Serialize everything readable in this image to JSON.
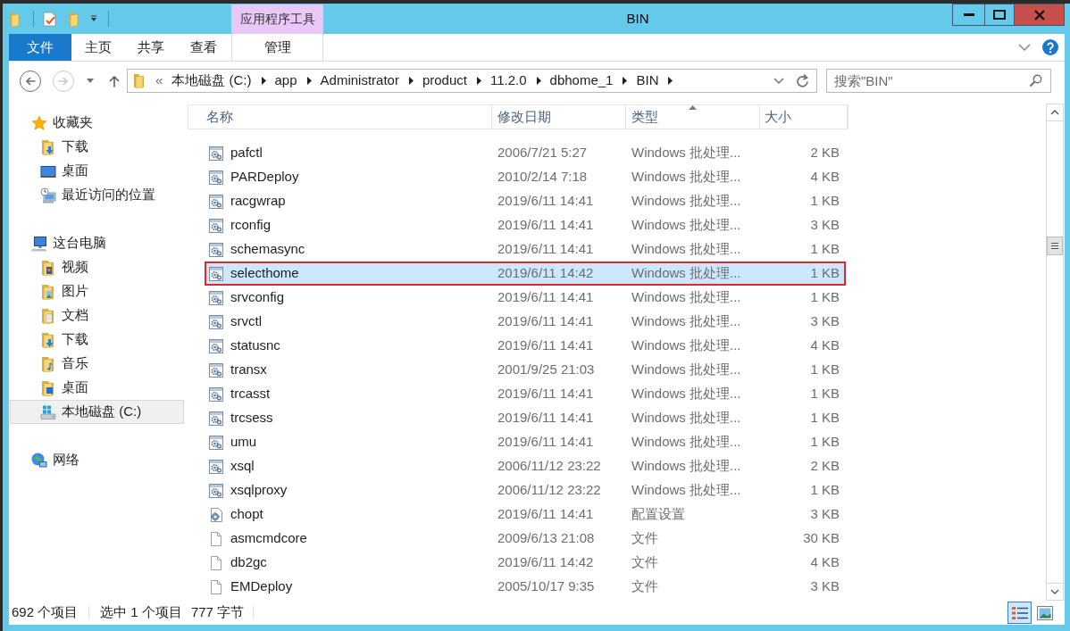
{
  "window": {
    "title": "BIN",
    "context_group": "应用程序工具"
  },
  "ribbon_tabs": [
    {
      "label": "文件",
      "kind": "file",
      "selected": false
    },
    {
      "label": "主页",
      "kind": "tab",
      "selected": false
    },
    {
      "label": "共享",
      "kind": "tab",
      "selected": false
    },
    {
      "label": "查看",
      "kind": "tab",
      "selected": false
    },
    {
      "label": "管理",
      "kind": "contextual",
      "selected": false
    }
  ],
  "navigation": [
    {
      "kind": "back",
      "disabled": false
    },
    {
      "kind": "forward",
      "disabled": true
    }
  ],
  "address_bar": {
    "overflow": "«",
    "path": [
      "本地磁盘 (C:)",
      "app",
      "Administrator",
      "product",
      "11.2.0",
      "dbhome_1",
      "BIN"
    ]
  },
  "search": {
    "placeholder": "搜索\"BIN\""
  },
  "sidebar": {
    "groups": [
      {
        "label": "收藏夹",
        "kind": "favorites",
        "selected": false,
        "children": [
          {
            "label": "下载",
            "kind": "downloads",
            "selected": false
          },
          {
            "label": "桌面",
            "kind": "desktop",
            "selected": false
          },
          {
            "label": "最近访问的位置",
            "kind": "recent",
            "selected": false
          }
        ]
      },
      {
        "label": "这台电脑",
        "kind": "computer",
        "selected": false,
        "children": [
          {
            "label": "视频",
            "kind": "videos",
            "selected": false
          },
          {
            "label": "图片",
            "kind": "pictures",
            "selected": false
          },
          {
            "label": "文档",
            "kind": "documents",
            "selected": false
          },
          {
            "label": "下载",
            "kind": "downloads",
            "selected": false
          },
          {
            "label": "音乐",
            "kind": "music",
            "selected": false
          },
          {
            "label": "桌面",
            "kind": "desktop_folder",
            "selected": false
          },
          {
            "label": "本地磁盘 (C:)",
            "kind": "drive",
            "selected": true
          }
        ]
      },
      {
        "label": "网络",
        "kind": "network",
        "selected": false
      }
    ]
  },
  "file_list": {
    "columns": [
      {
        "label": "名称",
        "sorted": false
      },
      {
        "label": "修改日期",
        "sorted": false
      },
      {
        "label": "类型",
        "sorted": true
      },
      {
        "label": "大小",
        "sorted": false
      }
    ],
    "rows": [
      {
        "kind": "batch",
        "name": "pafctl",
        "modified": "2006/7/21 5:27",
        "type": "Windows 批处理...",
        "size": "2 KB",
        "selected": false,
        "highlighted": false
      },
      {
        "kind": "batch",
        "name": "PARDeploy",
        "modified": "2010/2/14 7:18",
        "type": "Windows 批处理...",
        "size": "4 KB",
        "selected": false,
        "highlighted": false
      },
      {
        "kind": "batch",
        "name": "racgwrap",
        "modified": "2019/6/11 14:41",
        "type": "Windows 批处理...",
        "size": "1 KB",
        "selected": false,
        "highlighted": false
      },
      {
        "kind": "batch",
        "name": "rconfig",
        "modified": "2019/6/11 14:41",
        "type": "Windows 批处理...",
        "size": "3 KB",
        "selected": false,
        "highlighted": false
      },
      {
        "kind": "batch",
        "name": "schemasync",
        "modified": "2019/6/11 14:41",
        "type": "Windows 批处理...",
        "size": "1 KB",
        "selected": false,
        "highlighted": false
      },
      {
        "kind": "batch",
        "name": "selecthome",
        "modified": "2019/6/11 14:42",
        "type": "Windows 批处理...",
        "size": "1 KB",
        "selected": true,
        "highlighted": true
      },
      {
        "kind": "batch",
        "name": "srvconfig",
        "modified": "2019/6/11 14:41",
        "type": "Windows 批处理...",
        "size": "1 KB",
        "selected": false,
        "highlighted": false
      },
      {
        "kind": "batch",
        "name": "srvctl",
        "modified": "2019/6/11 14:41",
        "type": "Windows 批处理...",
        "size": "3 KB",
        "selected": false,
        "highlighted": false
      },
      {
        "kind": "batch",
        "name": "statusnc",
        "modified": "2019/6/11 14:41",
        "type": "Windows 批处理...",
        "size": "4 KB",
        "selected": false,
        "highlighted": false
      },
      {
        "kind": "batch",
        "name": "transx",
        "modified": "2001/9/25 21:03",
        "type": "Windows 批处理...",
        "size": "1 KB",
        "selected": false,
        "highlighted": false
      },
      {
        "kind": "batch",
        "name": "trcasst",
        "modified": "2019/6/11 14:41",
        "type": "Windows 批处理...",
        "size": "1 KB",
        "selected": false,
        "highlighted": false
      },
      {
        "kind": "batch",
        "name": "trcsess",
        "modified": "2019/6/11 14:41",
        "type": "Windows 批处理...",
        "size": "1 KB",
        "selected": false,
        "highlighted": false
      },
      {
        "kind": "batch",
        "name": "umu",
        "modified": "2019/6/11 14:41",
        "type": "Windows 批处理...",
        "size": "1 KB",
        "selected": false,
        "highlighted": false
      },
      {
        "kind": "batch",
        "name": "xsql",
        "modified": "2006/11/12 23:22",
        "type": "Windows 批处理...",
        "size": "2 KB",
        "selected": false,
        "highlighted": false
      },
      {
        "kind": "batch",
        "name": "xsqlproxy",
        "modified": "2006/11/12 23:22",
        "type": "Windows 批处理...",
        "size": "1 KB",
        "selected": false,
        "highlighted": false
      },
      {
        "kind": "config",
        "name": "chopt",
        "modified": "2019/6/11 14:41",
        "type": "配置设置",
        "size": "3 KB",
        "selected": false,
        "highlighted": false
      },
      {
        "kind": "file",
        "name": "asmcmdcore",
        "modified": "2009/6/13 21:08",
        "type": "文件",
        "size": "30 KB",
        "selected": false,
        "highlighted": false
      },
      {
        "kind": "file",
        "name": "db2gc",
        "modified": "2019/6/11 14:42",
        "type": "文件",
        "size": "4 KB",
        "selected": false,
        "highlighted": false
      },
      {
        "kind": "file",
        "name": "EMDeploy",
        "modified": "2005/10/17 9:35",
        "type": "文件",
        "size": "3 KB",
        "selected": false,
        "highlighted": false
      }
    ]
  },
  "status_bar": {
    "item_count": "692 个项目",
    "selection": "选中 1 个项目",
    "selection_size": "777 字节"
  },
  "view_modes": [
    {
      "kind": "details",
      "selected": true
    },
    {
      "kind": "large_icons",
      "selected": false
    }
  ]
}
